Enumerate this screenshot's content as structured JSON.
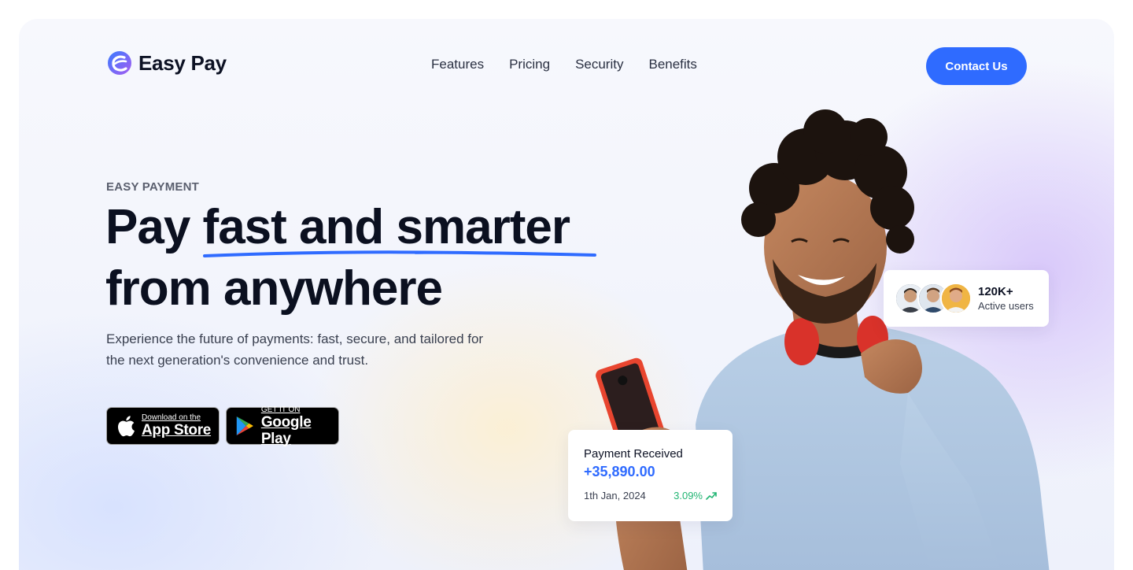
{
  "brand": {
    "name": "Easy Pay",
    "accent": "#2f6bff"
  },
  "nav": {
    "items": [
      {
        "label": "Features"
      },
      {
        "label": "Pricing"
      },
      {
        "label": "Security"
      },
      {
        "label": "Benefits"
      }
    ]
  },
  "header": {
    "cta_label": "Contact Us"
  },
  "hero": {
    "eyebrow": "EASY PAYMENT",
    "headline_plain": "Pay ",
    "headline_highlight": "fast and smarter",
    "headline_line2": "from anywhere",
    "subtitle": "Experience the future of payments: fast, secure, and tailored for the next generation's convenience and trust."
  },
  "stores": {
    "apple": {
      "small": "Download on the",
      "big": "App Store",
      "icon": "apple-icon"
    },
    "google": {
      "small": "GET IT ON",
      "big": "Google Play",
      "icon": "google-play-icon"
    }
  },
  "users_card": {
    "count": "120K+",
    "label": "Active users"
  },
  "payment_card": {
    "title": "Payment Received",
    "amount": "+35,890.00",
    "date": "1th Jan, 2024",
    "change": "3.09%",
    "change_color": "#22b573",
    "icon": "trend-up-icon"
  }
}
